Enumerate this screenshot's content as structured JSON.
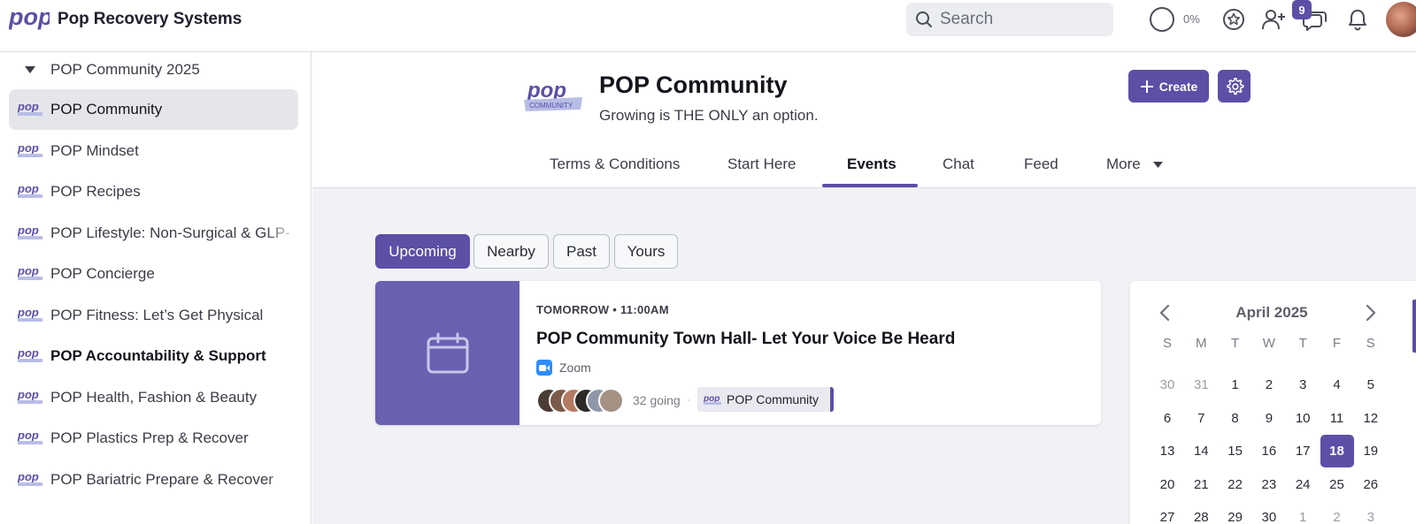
{
  "app": {
    "name": "Pop Recovery Systems",
    "logo_text": "pop"
  },
  "topbar": {
    "search_placeholder": "Search",
    "progress_text": "0%",
    "progress_value": 0,
    "notification_badge": "9"
  },
  "sidebar": {
    "group_label": "POP Community 2025",
    "items": [
      {
        "label": "POP Community",
        "active": true
      },
      {
        "label": "POP Mindset"
      },
      {
        "label": "POP Recipes"
      },
      {
        "label": "POP Lifestyle: Non-Surgical & GLP-"
      },
      {
        "label": "POP Concierge"
      },
      {
        "label": "POP Fitness: Let’s Get Physical"
      },
      {
        "label": "POP Accountability & Support",
        "bold": true
      },
      {
        "label": "POP Health, Fashion & Beauty"
      },
      {
        "label": "POP Plastics Prep & Recover"
      },
      {
        "label": "POP Bariatric Prepare & Recover"
      }
    ]
  },
  "group": {
    "title": "POP Community",
    "subtitle": "Growing is THE ONLY an option.",
    "logo_text": "pop",
    "logo_banner": "COMMUNITY",
    "create_label": "Create"
  },
  "tabs": [
    {
      "label": "Terms & Conditions"
    },
    {
      "label": "Start Here"
    },
    {
      "label": "Events",
      "active": true
    },
    {
      "label": "Chat"
    },
    {
      "label": "Feed"
    },
    {
      "label": "More"
    }
  ],
  "filters": [
    "Upcoming",
    "Nearby",
    "Past",
    "Yours"
  ],
  "event": {
    "when": "TOMORROW • 11:00AM",
    "title": "POP Community Town Hall- Let Your Voice Be Heard",
    "location": "Zoom",
    "going": "32 going",
    "separator": "·",
    "group_chip": "POP Community"
  },
  "calendar": {
    "month": "April 2025",
    "weekdays": [
      "S",
      "M",
      "T",
      "W",
      "T",
      "F",
      "S"
    ],
    "weeks": [
      [
        "30",
        "31",
        "1",
        "2",
        "3",
        "4",
        "5"
      ],
      [
        "6",
        "7",
        "8",
        "9",
        "10",
        "11",
        "12"
      ],
      [
        "13",
        "14",
        "15",
        "16",
        "17",
        "18",
        "19"
      ],
      [
        "20",
        "21",
        "22",
        "23",
        "24",
        "25",
        "26"
      ],
      [
        "27",
        "28",
        "29",
        "30",
        "1",
        "2",
        "3"
      ]
    ],
    "selected": "18"
  },
  "colors": {
    "accent": "#5b4fa6",
    "event_thumb": "#6961b0",
    "zoom": "#2d8cff"
  }
}
